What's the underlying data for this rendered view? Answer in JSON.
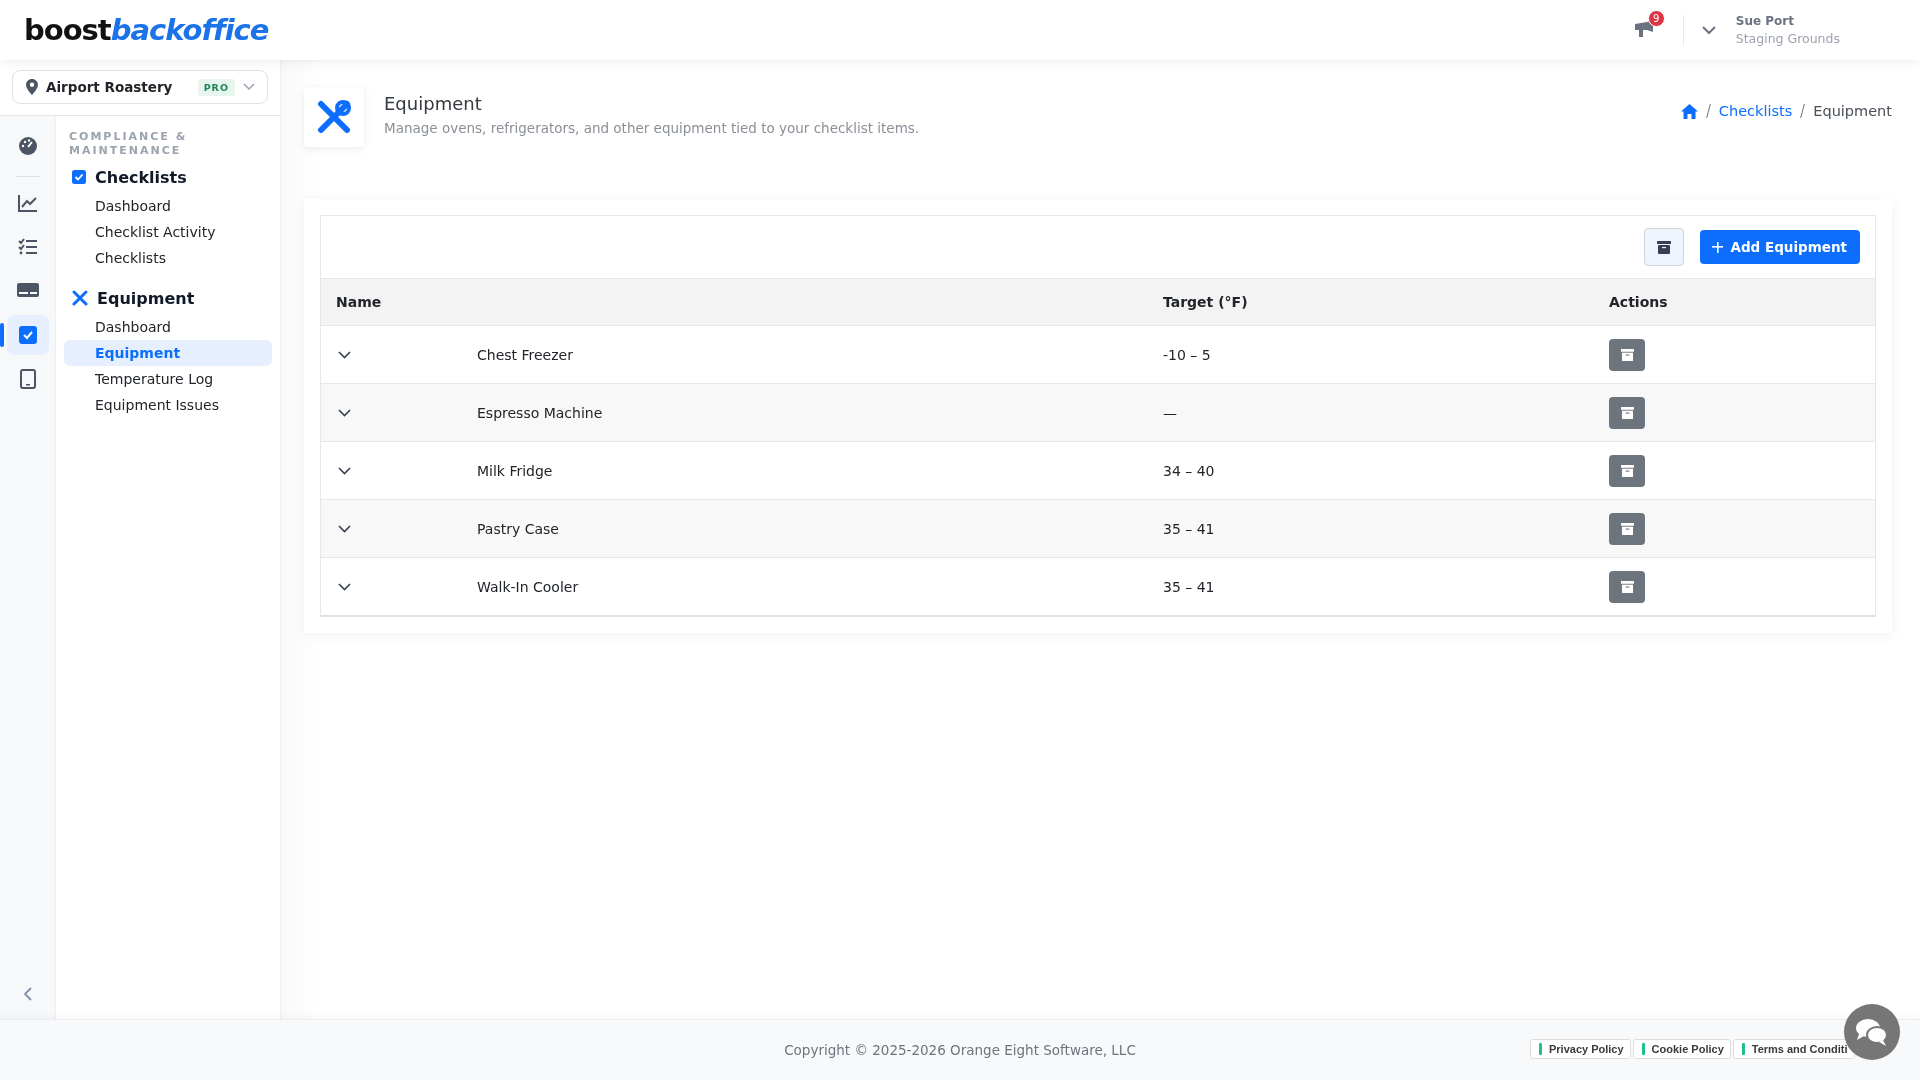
{
  "header": {
    "logo": {
      "primary": "boost",
      "secondary": "backoffice"
    },
    "notifications": {
      "count": "9"
    },
    "user": {
      "name": "Sue Port",
      "organization": "Staging Grounds"
    }
  },
  "location": {
    "name": "Airport Roastery",
    "badge": "PRO"
  },
  "rail": [
    {
      "selected": false
    },
    {
      "selected": false
    },
    {
      "selected": false
    },
    {
      "selected": false
    },
    {
      "selected": true
    },
    {
      "selected": false
    }
  ],
  "nav": {
    "heading": "COMPLIANCE & MAINTENANCE",
    "sections": [
      {
        "title": "Checklists",
        "items": [
          {
            "label": "Dashboard",
            "selected": false
          },
          {
            "label": "Checklist Activity",
            "selected": false
          },
          {
            "label": "Checklists",
            "selected": false
          }
        ]
      },
      {
        "title": "Equipment",
        "items": [
          {
            "label": "Dashboard",
            "selected": false
          },
          {
            "label": "Equipment",
            "selected": true
          },
          {
            "label": "Temperature Log",
            "selected": false
          },
          {
            "label": "Equipment Issues",
            "selected": false
          }
        ]
      }
    ]
  },
  "page": {
    "title": "Equipment",
    "subtitle": "Manage ovens, refrigerators, and other equipment tied to your checklist items.",
    "breadcrumb": [
      {
        "label": "Checklists",
        "kind": "link"
      },
      {
        "label": "Equipment",
        "kind": "current"
      }
    ]
  },
  "toolbar": {
    "add_button": "Add Equipment"
  },
  "table": {
    "columns": [
      "Name",
      "Target (°F)",
      "Actions"
    ],
    "rows": [
      {
        "name": "Chest Freezer",
        "target": "-10 – 5",
        "expanded": false
      },
      {
        "name": "Espresso Machine",
        "target": "—",
        "expanded": false
      },
      {
        "name": "Milk Fridge",
        "target": "34 – 40",
        "expanded": false
      },
      {
        "name": "Pastry Case",
        "target": "35 – 41",
        "expanded": false
      },
      {
        "name": "Walk-In Cooler",
        "target": "35 – 41",
        "expanded": false
      }
    ]
  },
  "footer": {
    "copyright": "Copyright © 2025-2026 Orange Eight Software, LLC",
    "links": [
      "Privacy Policy",
      "Cookie Policy",
      "Terms and Conditi"
    ]
  }
}
